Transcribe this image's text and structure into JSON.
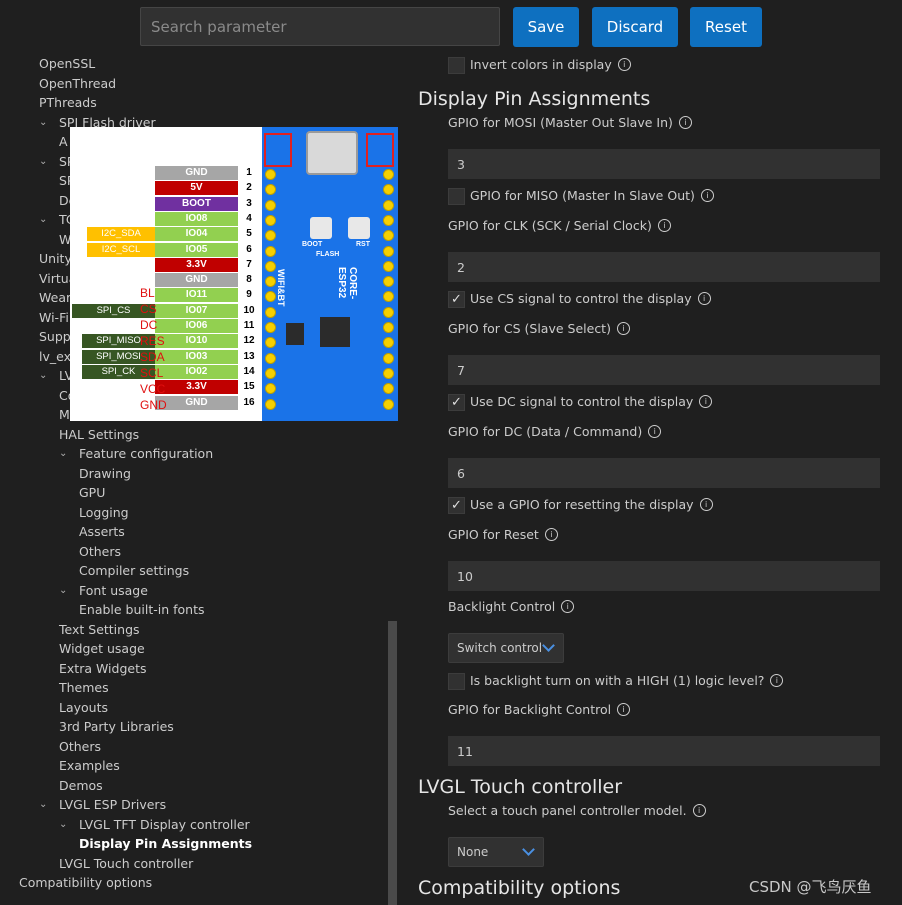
{
  "toolbar": {
    "search_placeholder": "Search parameter",
    "save_label": "Save",
    "discard_label": "Discard",
    "reset_label": "Reset",
    "button_color": "#0e70c0"
  },
  "tree": {
    "items": [
      {
        "label": "OpenSSL"
      },
      {
        "label": "OpenThread"
      },
      {
        "label": "PThreads"
      },
      {
        "label": "SPI Flash driver"
      },
      {
        "label": "A"
      },
      {
        "label": "SP"
      },
      {
        "label": "SP"
      },
      {
        "label": "De"
      },
      {
        "label": "TC"
      },
      {
        "label": "W"
      },
      {
        "label": "Unity"
      },
      {
        "label": "Virtua"
      },
      {
        "label": "Wear"
      },
      {
        "label": "Wi-Fi"
      },
      {
        "label": "Supp"
      },
      {
        "label": "lv_exa"
      },
      {
        "label": "LV"
      },
      {
        "label": "Co"
      },
      {
        "label": "M"
      },
      {
        "label": "HAL Settings"
      },
      {
        "label": "Feature configuration"
      },
      {
        "label": "Drawing"
      },
      {
        "label": "GPU"
      },
      {
        "label": "Logging"
      },
      {
        "label": "Asserts"
      },
      {
        "label": "Others"
      },
      {
        "label": "Compiler settings"
      },
      {
        "label": "Font usage"
      },
      {
        "label": "Enable built-in fonts"
      },
      {
        "label": "Text Settings"
      },
      {
        "label": "Widget usage"
      },
      {
        "label": "Extra Widgets"
      },
      {
        "label": "Themes"
      },
      {
        "label": "Layouts"
      },
      {
        "label": "3rd Party Libraries"
      },
      {
        "label": "Others"
      },
      {
        "label": "Examples"
      },
      {
        "label": "Demos"
      },
      {
        "label": "LVGL ESP Drivers"
      },
      {
        "label": "LVGL TFT Display controller"
      },
      {
        "label": "Display Pin Assignments"
      },
      {
        "label": "LVGL Touch controller"
      },
      {
        "label": "Compatibility options"
      }
    ]
  },
  "overlay": {
    "pins": [
      {
        "label": "GND",
        "num": "1",
        "color": "#a6a6a6"
      },
      {
        "label": "5V",
        "num": "2",
        "color": "#c00000"
      },
      {
        "label": "BOOT",
        "num": "3",
        "color": "#7030a0"
      },
      {
        "label": "IO08",
        "num": "4",
        "color": "#92d050"
      },
      {
        "label": "IO04",
        "num": "5",
        "color": "#92d050"
      },
      {
        "label": "IO05",
        "num": "6",
        "color": "#92d050"
      },
      {
        "label": "3.3V",
        "num": "7",
        "color": "#c00000"
      },
      {
        "label": "GND",
        "num": "8",
        "color": "#a6a6a6"
      },
      {
        "label": "IO11",
        "num": "9",
        "color": "#92d050"
      },
      {
        "label": "IO07",
        "num": "10",
        "color": "#92d050"
      },
      {
        "label": "IO06",
        "num": "11",
        "color": "#92d050"
      },
      {
        "label": "IO10",
        "num": "12",
        "color": "#92d050"
      },
      {
        "label": "IO03",
        "num": "13",
        "color": "#92d050"
      },
      {
        "label": "IO02",
        "num": "14",
        "color": "#92d050"
      },
      {
        "label": "3.3V",
        "num": "15",
        "color": "#c00000"
      },
      {
        "label": "GND",
        "num": "16",
        "color": "#a6a6a6"
      }
    ],
    "tags": [
      {
        "label": "I2C_SDA",
        "color": "#ffc000"
      },
      {
        "label": "I2C_SCL",
        "color": "#ffc000"
      },
      {
        "label": "SPI_CS",
        "color": "#375623"
      },
      {
        "label": "SPI_MISO",
        "color": "#375623"
      },
      {
        "label": "SPI_MOSI",
        "color": "#375623"
      },
      {
        "label": "SPI_CK",
        "color": "#375623"
      }
    ],
    "red_labels": [
      "BL",
      "CS",
      "DC",
      "RES",
      "SDA",
      "SCL",
      "VCC",
      "GND"
    ],
    "board": {
      "model": "CORE-ESP32",
      "wifi": "WIFI&BT",
      "boot": "BOOT",
      "rst": "RST",
      "flash": "FLASH"
    }
  },
  "panel": {
    "invert_colors_label": "Invert colors in display",
    "invert_colors_checked": false,
    "pins_heading": "Display Pin Assignments",
    "mosi_label": "GPIO for MOSI (Master Out Slave In)",
    "mosi_value": "3",
    "miso_label": "GPIO for MISO (Master In Slave Out)",
    "miso_checked": false,
    "clk_label": "GPIO for CLK (SCK / Serial Clock)",
    "clk_value": "2",
    "cs_check_label": "Use CS signal to control the display",
    "cs_checked": true,
    "cs_label": "GPIO for CS (Slave Select)",
    "cs_value": "7",
    "dc_check_label": "Use DC signal to control the display",
    "dc_checked": true,
    "dc_label": "GPIO for DC (Data / Command)",
    "dc_value": "6",
    "reset_check_label": "Use a GPIO for resetting the display",
    "reset_checked": true,
    "reset_label": "GPIO for Reset",
    "reset_value": "10",
    "backlight_label": "Backlight Control",
    "backlight_select": "Switch control",
    "backlight_high_label": "Is backlight turn on with a HIGH (1) logic level?",
    "backlight_high_checked": false,
    "backlight_gpio_label": "GPIO for Backlight Control",
    "backlight_gpio_value": "11",
    "touch_heading": "LVGL Touch controller",
    "touch_label": "Select a touch panel controller model.",
    "touch_select": "None",
    "compat_heading": "Compatibility options",
    "check_glyph": "✓",
    "info_glyph": "i"
  },
  "watermark": "CSDN @飞鸟厌鱼"
}
